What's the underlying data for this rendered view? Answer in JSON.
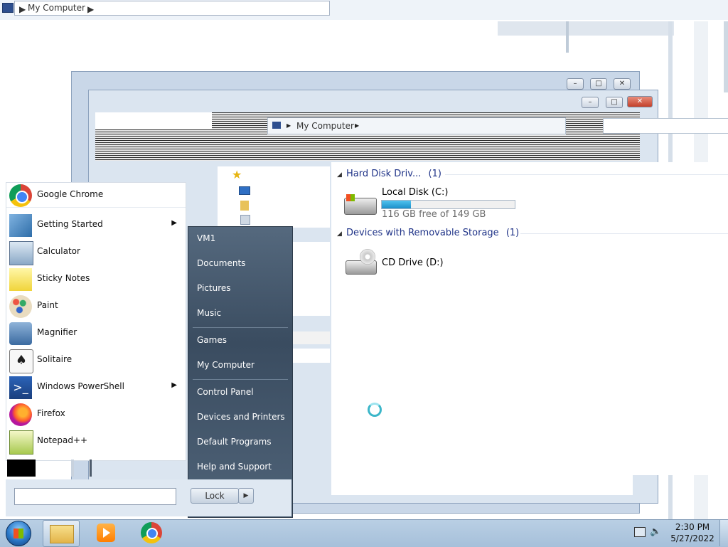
{
  "address_bar": {
    "root": "My Computer"
  },
  "inner_address_bar": {
    "root": "My Computer"
  },
  "explorer": {
    "sections": [
      {
        "title": "Hard Disk Driv...",
        "count": "(1)"
      },
      {
        "title": "Devices with Removable Storage",
        "count": "(1)"
      }
    ],
    "drives": [
      {
        "name": "Local Disk (C:)",
        "free_text": "116 GB free of 149 GB",
        "used_fraction": 0.22
      },
      {
        "name": "CD Drive (D:)"
      }
    ]
  },
  "start_menu": {
    "programs": [
      {
        "label": "Google Chrome",
        "icon": "chrome-icon"
      },
      {
        "label": "Getting Started",
        "icon": "getting-started-icon",
        "has_submenu": true
      },
      {
        "label": "Calculator",
        "icon": "calculator-icon"
      },
      {
        "label": "Sticky Notes",
        "icon": "sticky-notes-icon"
      },
      {
        "label": "Paint",
        "icon": "paint-icon"
      },
      {
        "label": "Magnifier",
        "icon": "magnifier-icon"
      },
      {
        "label": "Solitaire",
        "icon": "solitaire-icon"
      },
      {
        "label": "Windows PowerShell",
        "icon": "powershell-icon",
        "has_submenu": true
      },
      {
        "label": "Firefox",
        "icon": "firefox-icon"
      },
      {
        "label": "Notepad++",
        "icon": "notepadpp-icon"
      }
    ],
    "right_items": [
      "VM1",
      "Documents",
      "Pictures",
      "Music",
      "Games",
      "My Computer",
      "Control Panel",
      "Devices and Printers",
      "Default Programs",
      "Help and Support"
    ],
    "lock_label": "Lock",
    "search_value": ""
  },
  "tray": {
    "time": "2:30 PM",
    "date": "5/27/2022"
  },
  "colors": {
    "section_heading": "#1e3287",
    "progress": "#26a0da",
    "start_menu_right": "#45586c",
    "taskbar": "#b1c8df"
  }
}
